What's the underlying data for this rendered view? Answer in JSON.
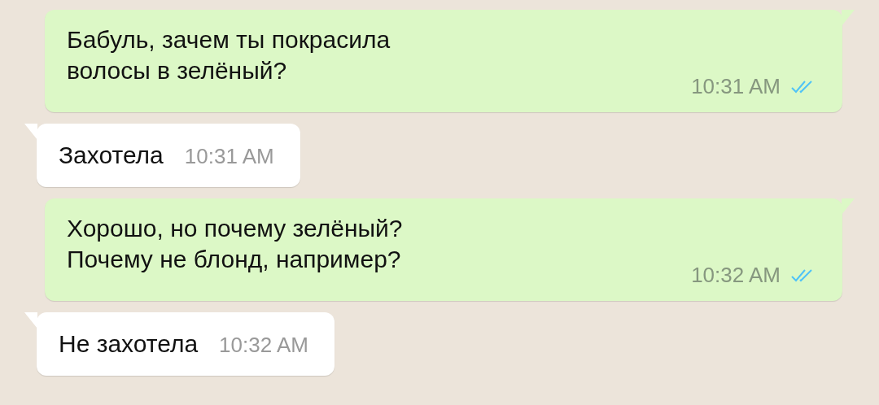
{
  "messages": [
    {
      "kind": "outgoing",
      "text": "Бабуль, зачем ты покрасила\nволосы в зелёный?",
      "time": "10:31 AM",
      "read": true
    },
    {
      "kind": "incoming",
      "text": "Захотела",
      "time": "10:31 AM"
    },
    {
      "kind": "outgoing",
      "text": "Хорошо, но почему зелёный?\nПочему не блонд, например?",
      "time": "10:32 AM",
      "read": true
    },
    {
      "kind": "incoming",
      "text": "Не захотела",
      "time": "10:32 AM"
    }
  ]
}
